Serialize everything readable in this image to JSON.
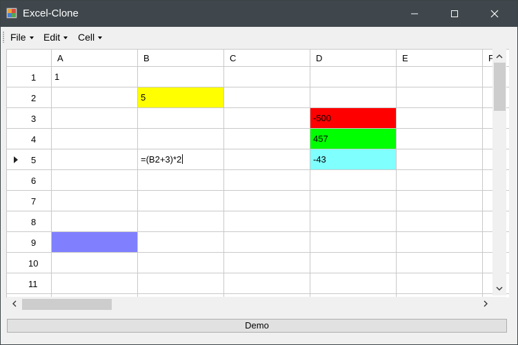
{
  "window": {
    "title": "Excel-Clone"
  },
  "menu": {
    "items": [
      "File",
      "Edit",
      "Cell"
    ]
  },
  "grid": {
    "columns": [
      "A",
      "B",
      "C",
      "D",
      "E",
      "F"
    ],
    "rows": [
      "1",
      "2",
      "3",
      "4",
      "5",
      "6",
      "7",
      "8",
      "9",
      "10",
      "11",
      ""
    ],
    "current_row": "5",
    "cells": [
      {
        "ref": "A1",
        "value": "1"
      },
      {
        "ref": "B2",
        "value": "5",
        "bg": "#ffff00"
      },
      {
        "ref": "D3",
        "value": "-500",
        "bg": "#ff0000"
      },
      {
        "ref": "D4",
        "value": "457",
        "bg": "#00ff00"
      },
      {
        "ref": "B5",
        "value": "=(B2+3)*2",
        "editing": true
      },
      {
        "ref": "D5",
        "value": "-43",
        "bg": "#80ffff"
      },
      {
        "ref": "A9",
        "value": "",
        "bg": "#8080ff"
      }
    ]
  },
  "footer": {
    "button_label": "Demo"
  },
  "colors": {
    "titlebar": "#3f474c",
    "grid_line": "#c8c8c8"
  }
}
